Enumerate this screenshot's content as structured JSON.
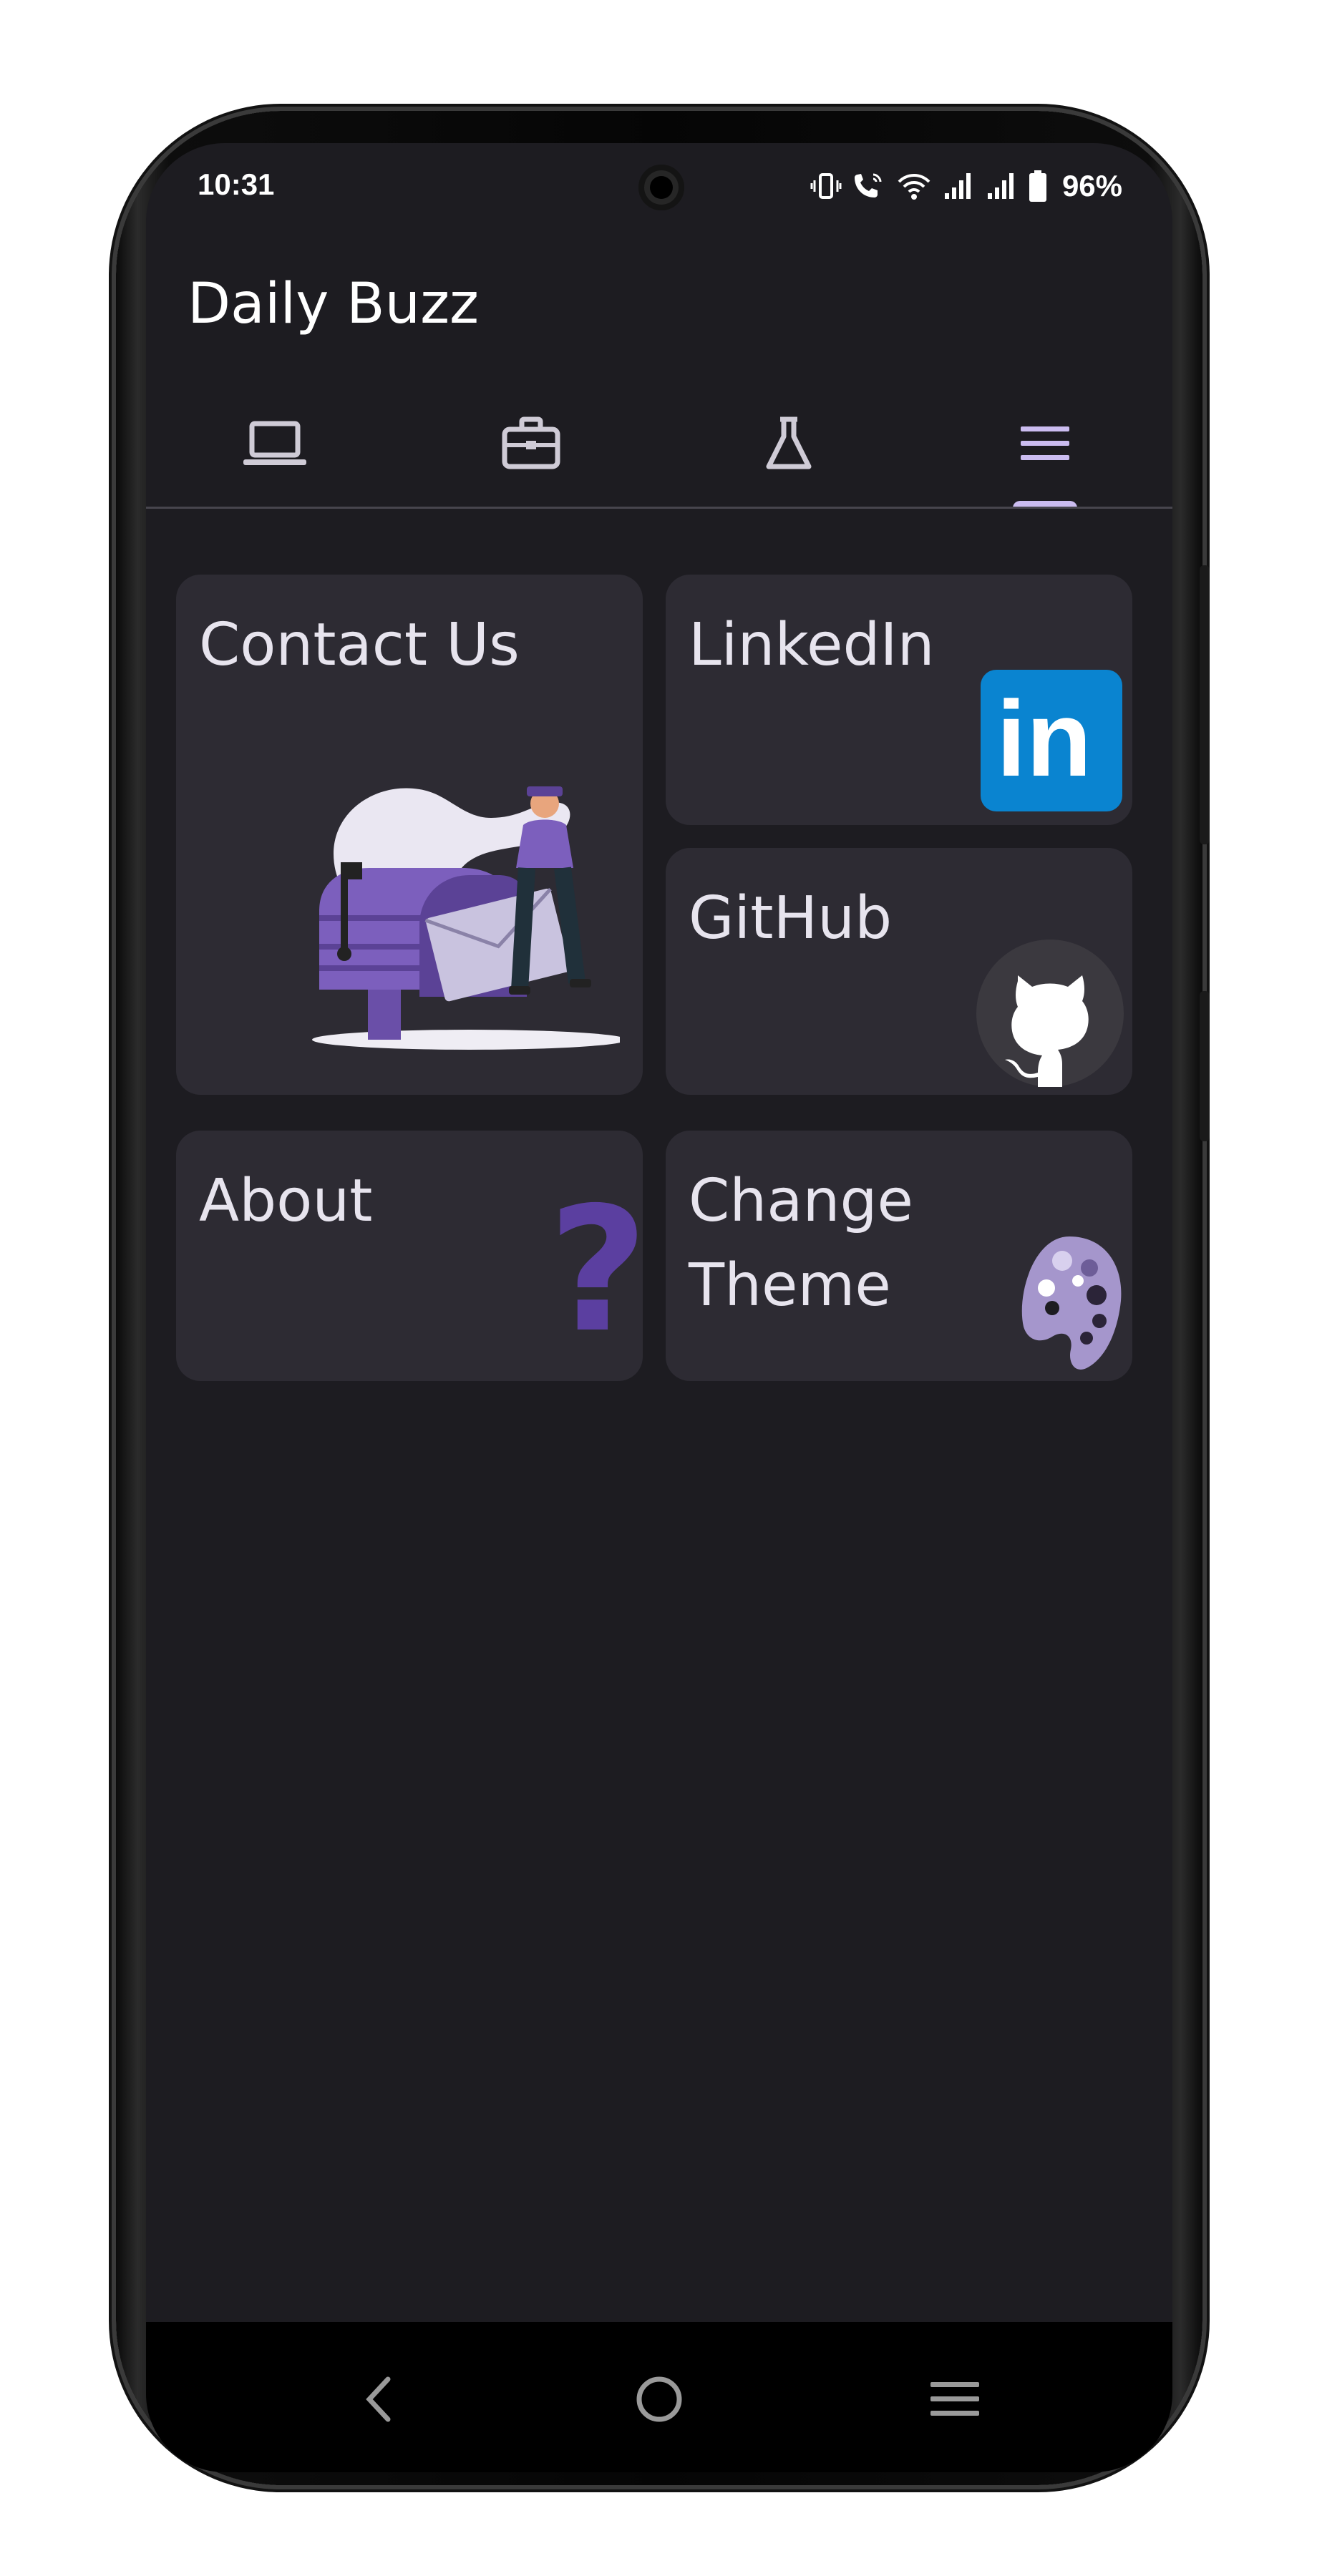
{
  "status_bar": {
    "time": "10:31",
    "battery": "96%",
    "icons": [
      "vibrate-icon",
      "wifi-calling-icon",
      "wifi-icon",
      "signal-icon",
      "signal-icon",
      "battery-icon"
    ]
  },
  "app_bar": {
    "title": "Daily Buzz"
  },
  "tabs": [
    {
      "icon": "laptop-icon",
      "selected": false
    },
    {
      "icon": "briefcase-icon",
      "selected": false
    },
    {
      "icon": "flask-icon",
      "selected": false
    },
    {
      "icon": "menu-icon",
      "selected": true
    }
  ],
  "cards": {
    "contact": {
      "title": "Contact Us",
      "art": "mailbox-illustration"
    },
    "linkedin": {
      "title": "LinkedIn",
      "art": "linkedin-logo",
      "logo_text": "in"
    },
    "github": {
      "title": "GitHub",
      "art": "github-logo"
    },
    "about": {
      "title": "About",
      "art": "question-mark-icon",
      "glyph": "?"
    },
    "theme": {
      "title_line1": "Change",
      "title_line2": "Theme",
      "art": "palette-icon"
    }
  },
  "nav_bar": {
    "buttons": [
      "back-icon",
      "home-icon",
      "recents-icon"
    ]
  },
  "colors": {
    "background": "#1d1c21",
    "card": "#2d2b33",
    "accent": "#cbbcf0",
    "purple": "#6a4fa8",
    "linkedin_blue": "#0a84d0",
    "text": "#e7e4ee"
  }
}
